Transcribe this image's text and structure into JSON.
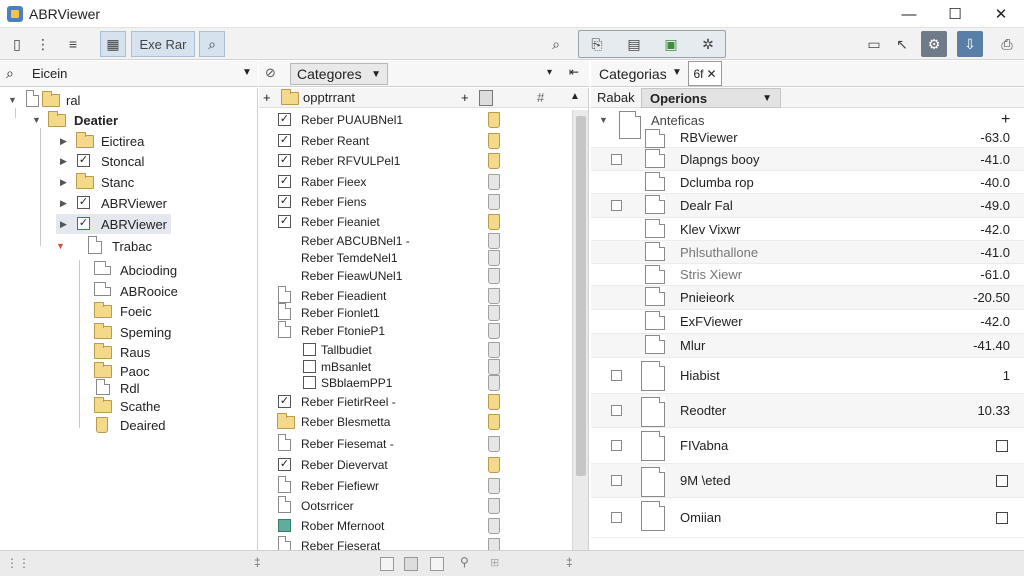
{
  "window": {
    "title": "ABRViewer",
    "minimize": "—",
    "maximize": "☐",
    "close": "✕"
  },
  "toolbar": {
    "text_button": "Exe Rar"
  },
  "left_header": {
    "search_value": "Eicein"
  },
  "mid_header": {
    "category_label": "Categores",
    "more": "▾",
    "pin": "⇤"
  },
  "right_header": {
    "category_label": "Categorias",
    "tab_label": "6f",
    "tab_close": "✕"
  },
  "left_tree": [
    {
      "label": "ral",
      "kind": "folder-root"
    },
    {
      "label": "Deatier",
      "kind": "folder",
      "bold": true
    },
    {
      "label": "Eictirea",
      "kind": "folder"
    },
    {
      "label": "Stoncal",
      "kind": "check",
      "checked": true
    },
    {
      "label": "Stanc",
      "kind": "folder"
    },
    {
      "label": "ABRViewer",
      "kind": "check",
      "checked": true
    },
    {
      "label": "ABRViewer",
      "kind": "check",
      "checked": true,
      "selected": true
    },
    {
      "label": "Trabac",
      "kind": "doc"
    },
    {
      "label": "Abcioding",
      "kind": "doc-small"
    },
    {
      "label": "ABRooice",
      "kind": "doc-small"
    },
    {
      "label": "Foeic",
      "kind": "folder-small"
    },
    {
      "label": "Speming",
      "kind": "folder-small"
    },
    {
      "label": "Raus",
      "kind": "folder-small"
    },
    {
      "label": "Paoc",
      "kind": "folder-small"
    },
    {
      "label": "Rdl",
      "kind": "folder-small"
    },
    {
      "label": "Scathe",
      "kind": "folder-small"
    },
    {
      "label": "Deaired",
      "kind": "folder-small"
    }
  ],
  "mid_list": {
    "header": {
      "label": "opptrrant",
      "plus": "+",
      "hash": "#",
      "up": "▲"
    },
    "rows": [
      {
        "label": "Reber PUAUBNel1",
        "check": "checked",
        "tag": "yellow"
      },
      {
        "label": "Reber Reant",
        "check": "checked",
        "tag": "yellow"
      },
      {
        "label": "Reber RFVULPel1",
        "check": "checked",
        "tag": "yellow"
      },
      {
        "label": "Raber Fieex",
        "check": "checked",
        "tag": "gray"
      },
      {
        "label": "Reber Fiens",
        "check": "checked",
        "tag": "gray"
      },
      {
        "label": "Reber Fieaniet",
        "check": "checked",
        "tag": "yellow"
      },
      {
        "label": "Reber ABCUBNel1 -",
        "check": "none",
        "tag": "gray"
      },
      {
        "label": "Reber TemdeNel1",
        "check": "none",
        "tag": "gray"
      },
      {
        "label": "Reber FieawUNel1",
        "check": "none",
        "tag": "gray"
      },
      {
        "label": "Reber Fieadient",
        "check": "doc",
        "tag": "gray"
      },
      {
        "label": "Reber Fionlet1",
        "check": "doc",
        "tag": "gray"
      },
      {
        "label": "Reber FtonieP1",
        "check": "doc",
        "tag": "gray"
      },
      {
        "label": "Tallbudiet",
        "check": "empty",
        "tag": "gray"
      },
      {
        "label": "mBsanlet",
        "check": "empty",
        "tag": "gray"
      },
      {
        "label": "SBblaemPP1",
        "check": "empty",
        "tag": "gray"
      },
      {
        "label": "Reber FietirReel -",
        "check": "checked",
        "tag": "yellow"
      },
      {
        "label": "Reber Blesmetta",
        "check": "folder",
        "tag": "yellow"
      },
      {
        "label": "Reber Fiesemat -",
        "check": "doc",
        "tag": "gray"
      },
      {
        "label": "Reber Dievervat",
        "check": "checked",
        "tag": "yellow"
      },
      {
        "label": "Reber Fiefiewr",
        "check": "doc",
        "tag": "gray"
      },
      {
        "label": "Ootsrricer",
        "check": "doc",
        "tag": "gray"
      },
      {
        "label": "Rober Mfernoot",
        "check": "teal",
        "tag": "gray"
      },
      {
        "label": "Reber Fieserat",
        "check": "doc",
        "tag": "gray"
      }
    ]
  },
  "right_list": {
    "tab_left": "Rabak",
    "tab_active": "Operions",
    "plus": "+",
    "group": "Anteficas",
    "rows": [
      {
        "label": "RBViewer",
        "value": "-63.0"
      },
      {
        "label": "Dlapngs booy",
        "value": "-41.0"
      },
      {
        "label": "Dclumba rop",
        "value": "-40.0"
      },
      {
        "label": "Dealr Fal",
        "value": "-49.0"
      },
      {
        "label": "Klev Vixwr",
        "value": "-42.0"
      },
      {
        "label": "Phlsuthallone",
        "value": "-41.0"
      },
      {
        "label": "Stris Xiewr",
        "value": "-61.0"
      },
      {
        "label": "Pnieieork",
        "value": "-20.50"
      },
      {
        "label": "ExFViewer",
        "value": "-42.0"
      },
      {
        "label": "Mlur",
        "value": "-41.40"
      },
      {
        "label": "Hiabist",
        "value": "1"
      },
      {
        "label": "Reodter",
        "value": "10.33"
      },
      {
        "label": "FIVabna",
        "value": ""
      },
      {
        "label": "9M \\eted",
        "value": ""
      },
      {
        "label": "Omiian",
        "value": ""
      }
    ]
  }
}
